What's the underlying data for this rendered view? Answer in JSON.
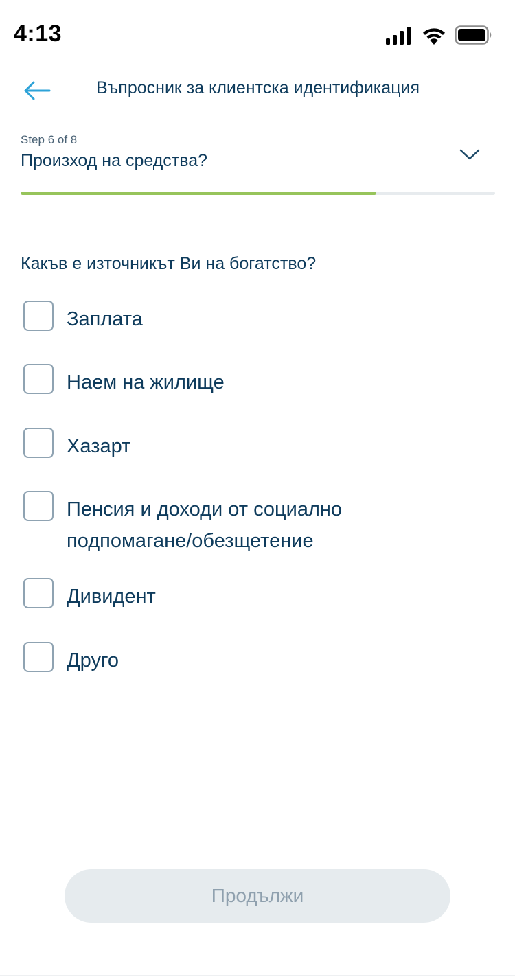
{
  "status_bar": {
    "time": "4:13",
    "icons": [
      "signal-icon",
      "wifi-icon",
      "battery-icon"
    ]
  },
  "nav": {
    "back_icon": "arrow-left-icon",
    "title": "Въпросник за клиентска идентификация"
  },
  "step": {
    "counter": "Step 6 of 8",
    "title": "Произход на средства?",
    "toggle_icon": "chevron-down-icon",
    "current": 6,
    "total": 8,
    "progress": 0.75
  },
  "question": "Какъв е източникът Ви на богатство?",
  "options": [
    {
      "label": "Заплата",
      "checked": false
    },
    {
      "label": "Наем на жилище",
      "checked": false
    },
    {
      "label": "Хазарт",
      "checked": false
    },
    {
      "label": "Пенсия и доходи от социално подпомагане/обезщетение",
      "checked": false
    },
    {
      "label": "Дивидент",
      "checked": false
    },
    {
      "label": "Друго",
      "checked": false
    }
  ],
  "continue_button": {
    "label": "Продължи",
    "enabled": false
  },
  "colors": {
    "primary_text": "#0e3b5c",
    "accent_blue": "#2ea3d8",
    "progress_green": "#97c45b",
    "disabled_bg": "#e6ebee",
    "disabled_text": "#8fa0ae"
  }
}
